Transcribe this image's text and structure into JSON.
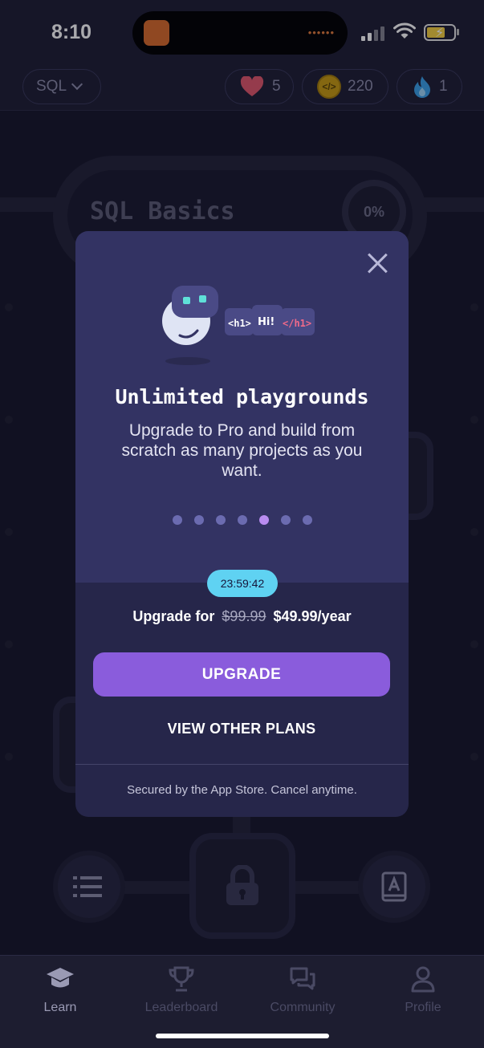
{
  "status_bar": {
    "time": "8:10"
  },
  "topbar": {
    "language": "SQL",
    "hearts": "5",
    "coins": "220",
    "streak": "1"
  },
  "course": {
    "title": "SQL Basics",
    "progress": "0%"
  },
  "modal": {
    "illustration_code": {
      "open_tag": "<h1>",
      "text": "Hi!",
      "close_tag": "</h1>"
    },
    "title": "Unlimited playgrounds",
    "description": "Upgrade to Pro and build from scratch as many projects as you want.",
    "pager": {
      "count": 7,
      "active_index": 4
    },
    "timer": "23:59:42",
    "price_prefix": "Upgrade for",
    "old_price": "$99.99",
    "new_price": "$49.99/year",
    "upgrade_label": "UPGRADE",
    "other_plans_label": "VIEW OTHER PLANS",
    "footer_note": "Secured by the App Store. Cancel anytime."
  },
  "tabs": [
    {
      "label": "Learn",
      "icon": "graduation-cap-icon",
      "active": true
    },
    {
      "label": "Leaderboard",
      "icon": "trophy-icon",
      "active": false
    },
    {
      "label": "Community",
      "icon": "chat-icon",
      "active": false
    },
    {
      "label": "Profile",
      "icon": "person-icon",
      "active": false
    }
  ],
  "colors": {
    "accent": "#8a5cdc",
    "timer": "#5fd2f2",
    "heart": "#e0566a",
    "coin": "#c79a10",
    "streak": "#3aa0e8"
  }
}
